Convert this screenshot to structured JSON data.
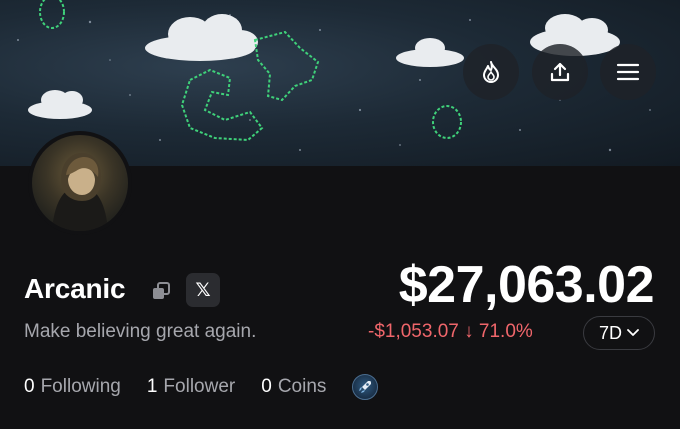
{
  "profile": {
    "username": "Arcanic",
    "bio": "Make believing great again.",
    "social_badge": "𝕏"
  },
  "portfolio": {
    "balance": "$27,063.02",
    "change": "-$1,053.07 ↓ 71.0%",
    "period": "7D"
  },
  "stats": {
    "following_count": "0",
    "following_label": "Following",
    "followers_count": "1",
    "followers_label": "Follower",
    "coins_count": "0",
    "coins_label": "Coins"
  },
  "header_buttons": [
    "flame-icon",
    "share-icon",
    "menu-icon"
  ],
  "colors": {
    "background": "#111113",
    "negative": "#f0666b",
    "muted_text": "#a6a7ad",
    "pixel_art": "#3fd17a"
  }
}
